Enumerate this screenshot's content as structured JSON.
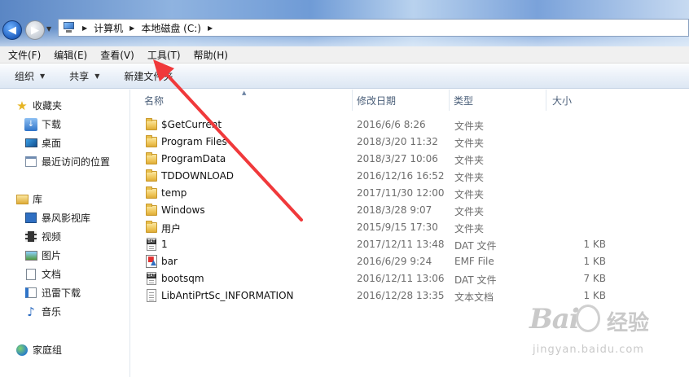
{
  "address": {
    "path": [
      "计算机",
      "本地磁盘 (C:)"
    ]
  },
  "menu": [
    "文件(F)",
    "编辑(E)",
    "查看(V)",
    "工具(T)",
    "帮助(H)"
  ],
  "toolbar": {
    "organize": "组织",
    "share": "共享",
    "new_folder": "新建文件夹"
  },
  "nav": {
    "favorites": {
      "label": "收藏夹",
      "items": [
        "下载",
        "桌面",
        "最近访问的位置"
      ]
    },
    "libraries": {
      "label": "库",
      "items": [
        "暴风影视库",
        "视频",
        "图片",
        "文档",
        "迅雷下载",
        "音乐"
      ]
    },
    "homegroup": {
      "label": "家庭组"
    }
  },
  "columns": {
    "name": "名称",
    "date": "修改日期",
    "type": "类型",
    "size": "大小"
  },
  "files": [
    {
      "name": "$GetCurrent",
      "date": "2016/6/6 8:26",
      "type": "文件夹",
      "size": "",
      "icon": "folder-icon"
    },
    {
      "name": "Program Files",
      "date": "2018/3/20 11:32",
      "type": "文件夹",
      "size": "",
      "icon": "folder-icon"
    },
    {
      "name": "ProgramData",
      "date": "2018/3/27 10:06",
      "type": "文件夹",
      "size": "",
      "icon": "folder-icon"
    },
    {
      "name": "TDDOWNLOAD",
      "date": "2016/12/16 16:52",
      "type": "文件夹",
      "size": "",
      "icon": "folder-icon"
    },
    {
      "name": "temp",
      "date": "2017/11/30 12:00",
      "type": "文件夹",
      "size": "",
      "icon": "folder-icon"
    },
    {
      "name": "Windows",
      "date": "2018/3/28 9:07",
      "type": "文件夹",
      "size": "",
      "icon": "folder-icon"
    },
    {
      "name": "用户",
      "date": "2015/9/15 17:30",
      "type": "文件夹",
      "size": "",
      "icon": "folder-icon"
    },
    {
      "name": "1",
      "date": "2017/12/11 13:48",
      "type": "DAT 文件",
      "size": "1 KB",
      "icon": "dat-file-icon"
    },
    {
      "name": "bar",
      "date": "2016/6/29 9:24",
      "type": "EMF File",
      "size": "1 KB",
      "icon": "emf-file-icon"
    },
    {
      "name": "bootsqm",
      "date": "2016/12/11 13:06",
      "type": "DAT 文件",
      "size": "7 KB",
      "icon": "dat-file-icon"
    },
    {
      "name": "LibAntiPrtSc_INFORMATION",
      "date": "2016/12/28 13:35",
      "type": "文本文档",
      "size": "1 KB",
      "icon": "text-file-icon"
    }
  ],
  "watermark": {
    "logo": "Bai",
    "brand": "经验",
    "url": "jingyan.baidu.com"
  },
  "colors": {
    "annotation_arrow": "#f0393b",
    "folder": "#efc75b",
    "header_text": "#4c607a"
  }
}
